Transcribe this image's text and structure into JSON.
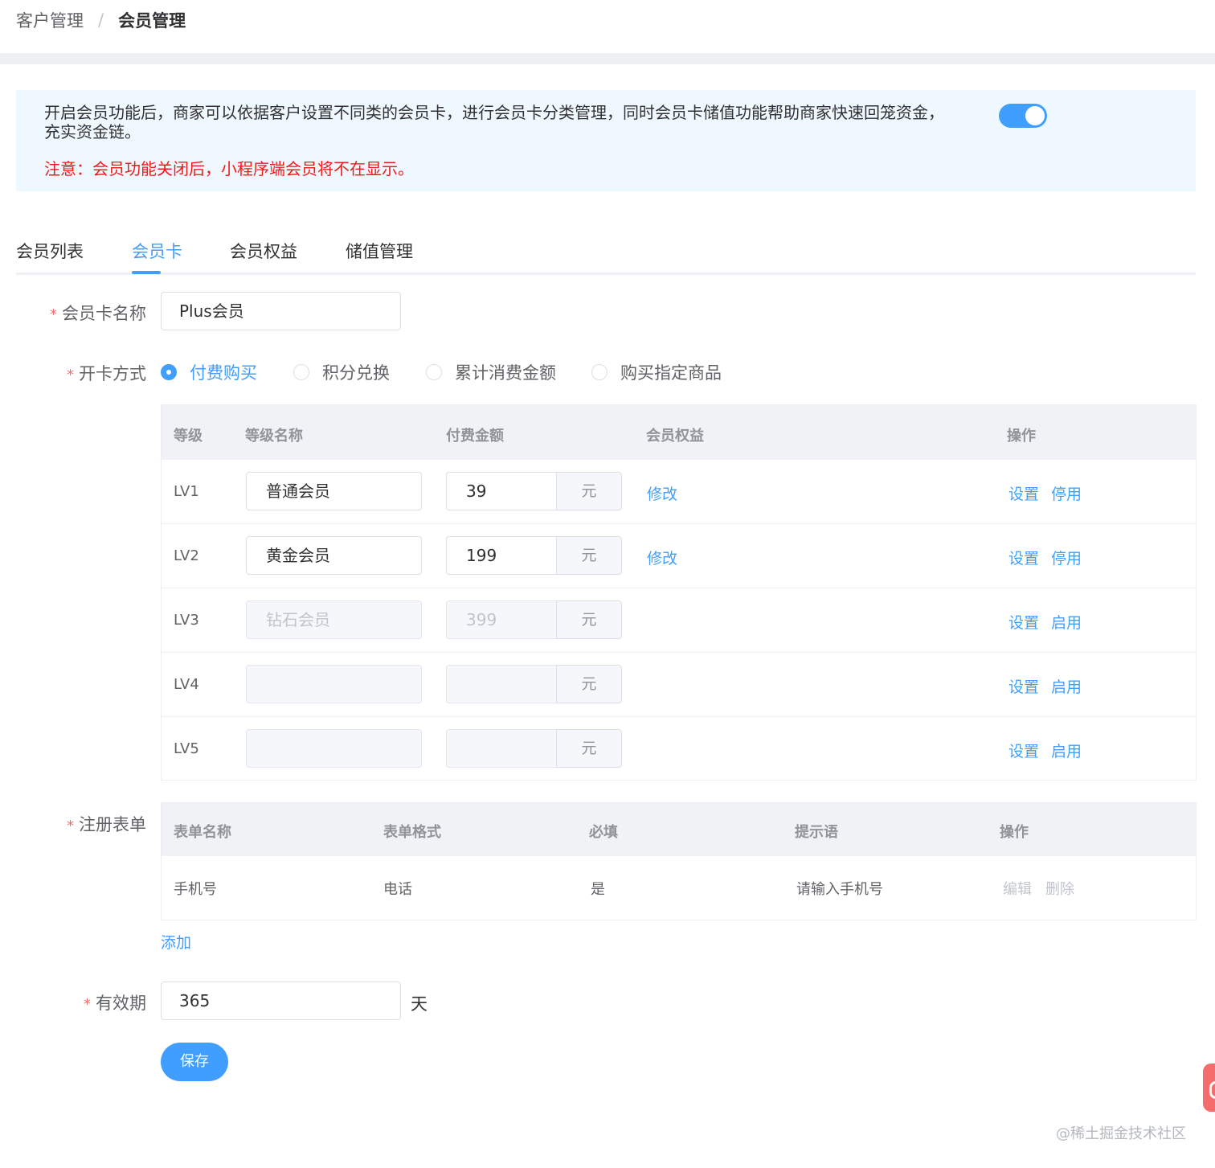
{
  "breadcrumb": {
    "parent": "客户管理",
    "separator": "/",
    "current": "会员管理"
  },
  "notice": {
    "text": "开启会员功能后，商家可以依据客户设置不同类的会员卡，进行会员卡分类管理，同时会员卡储值功能帮助商家快速回笼资金，充实资金链。",
    "warning": "注意：会员功能关闭后，小程序端会员将不在显示。",
    "switch_on": true
  },
  "tabs": [
    {
      "label": "会员列表"
    },
    {
      "label": "会员卡",
      "active": true
    },
    {
      "label": "会员权益"
    },
    {
      "label": "储值管理"
    }
  ],
  "form": {
    "card_name": {
      "label": "会员卡名称",
      "value": "Plus会员"
    },
    "open_method": {
      "label": "开卡方式",
      "options": [
        "付费购买",
        "积分兑换",
        "累计消费金额",
        "购买指定商品"
      ],
      "selected": "付费购买"
    },
    "level_table": {
      "headers": [
        "等级",
        "等级名称",
        "付费金额",
        "会员权益",
        "操作"
      ],
      "currency_unit": "元",
      "rows": [
        {
          "level": "LV1",
          "name": "普通会员",
          "amount": "39",
          "benefit": "修改",
          "action1": "设置",
          "action2": "停用",
          "disabled": false
        },
        {
          "level": "LV2",
          "name": "黄金会员",
          "amount": "199",
          "benefit": "修改",
          "action1": "设置",
          "action2": "停用",
          "disabled": false
        },
        {
          "level": "LV3",
          "name": "钻石会员",
          "amount": "399",
          "benefit": "",
          "action1": "设置",
          "action2": "启用",
          "disabled": true
        },
        {
          "level": "LV4",
          "name": "",
          "amount": "",
          "benefit": "",
          "action1": "设置",
          "action2": "启用",
          "disabled": true
        },
        {
          "level": "LV5",
          "name": "",
          "amount": "",
          "benefit": "",
          "action1": "设置",
          "action2": "启用",
          "disabled": true
        }
      ]
    },
    "register_form": {
      "label": "注册表单",
      "headers": [
        "表单名称",
        "表单格式",
        "必填",
        "提示语",
        "操作"
      ],
      "rows": [
        {
          "name": "手机号",
          "format": "电话",
          "required": "是",
          "hint": "请输入手机号",
          "edit": "编辑",
          "delete": "删除"
        }
      ],
      "add_label": "添加"
    },
    "validity": {
      "label": "有效期",
      "value": "365",
      "unit": "天"
    },
    "save_label": "保存"
  },
  "watermark": "@稀土掘金技术社区",
  "colors": {
    "primary": "#409eff",
    "danger": "#f01a1a",
    "notice_bg": "#f0f8ff"
  }
}
